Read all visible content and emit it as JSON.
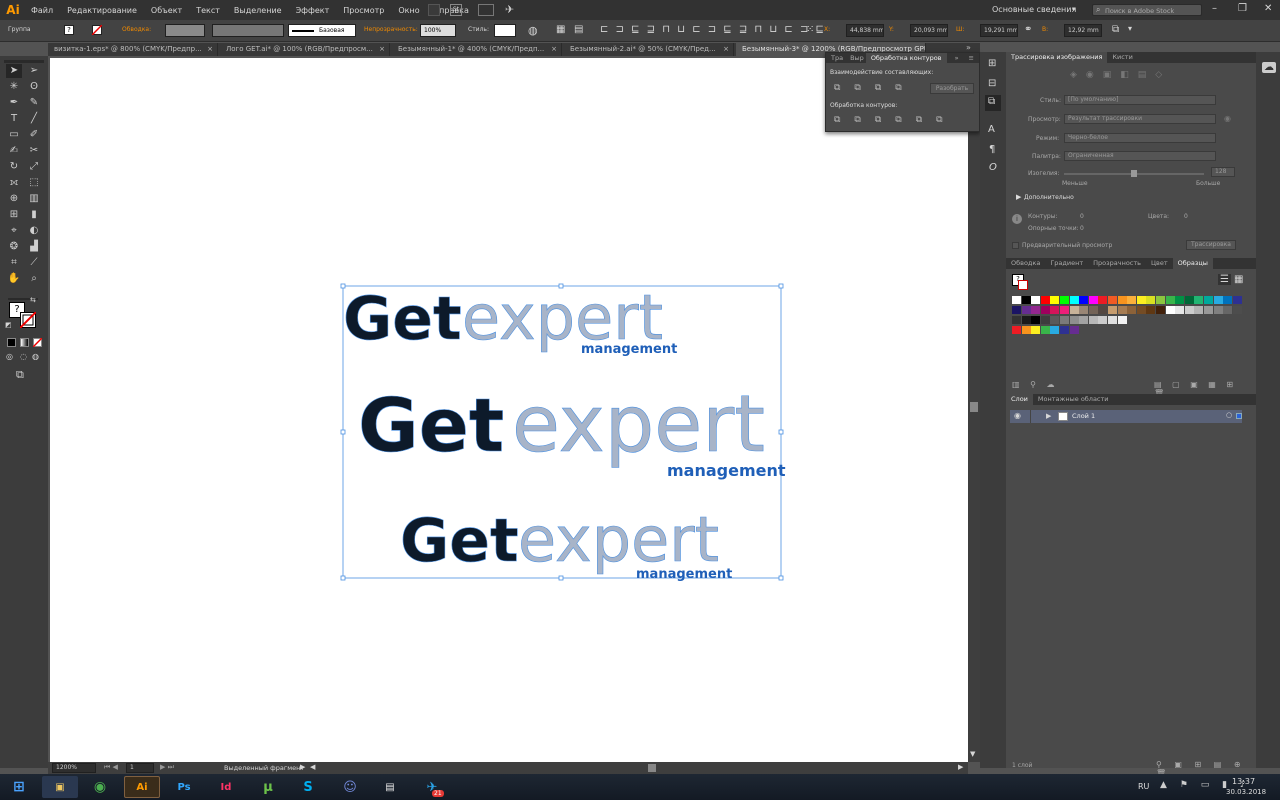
{
  "menubar": {
    "logo": "Ai",
    "items": [
      "Файл",
      "Редактирование",
      "Объект",
      "Текст",
      "Выделение",
      "Эффект",
      "Просмотр",
      "Окно",
      "Справка"
    ],
    "workspace": "Основные сведения",
    "search_placeholder": "Поиск в Adobe Stock"
  },
  "control_bar": {
    "selection_type": "Группа",
    "stroke_label": "Обводка:",
    "stroke_profile": "Базовая",
    "opacity_label": "Непрозрачность:",
    "opacity_value": "100%",
    "style_label": "Стиль:",
    "x_label": "X:",
    "x_value": "44,838 mm",
    "y_label": "Y:",
    "y_value": "20,093 mm",
    "w_label": "Ш:",
    "w_value": "19,291 mm",
    "h_label": "В:",
    "h_value": "12,92 mm"
  },
  "doc_tabs": [
    {
      "label": "визитка-1.eps* @ 800% (CMYK/Предпр...",
      "active": false
    },
    {
      "label": "Лого GET.ai* @ 100% (RGB/Предпросм...",
      "active": false
    },
    {
      "label": "Безымянный-1* @ 400% (CMYK/Предп...",
      "active": false
    },
    {
      "label": "Безымянный-2.ai* @ 50% (CMYK/Пред...",
      "active": false
    },
    {
      "label": "Безымянный-3* @ 1200% (RGB/Предпросмотр GPU)",
      "active": true
    }
  ],
  "pathfinder_panel": {
    "tabs": [
      "Тра",
      "Выр",
      "Обработка контуров"
    ],
    "shape_modes_label": "Взаимодействие составляющих:",
    "expand_button": "Разобрать",
    "pathfinders_label": "Обработка контуров:"
  },
  "trace_panel": {
    "tabs": [
      "Трассировка изображения",
      "Кисти"
    ],
    "preset_label": "Стиль:",
    "preset_value": "[По умолчанию]",
    "view_label": "Просмотр:",
    "view_value": "Результат трассировки",
    "mode_label": "Режим:",
    "mode_value": "Черно-белое",
    "palette_label": "Палитра:",
    "palette_value": "Ограниченная",
    "threshold_label": "Изогелия:",
    "threshold_value": "128",
    "less_label": "Меньше",
    "more_label": "Больше",
    "advanced_label": "Дополнительно",
    "paths_label": "Контуры:",
    "paths_value": "0",
    "colors_label": "Цвета:",
    "colors_value": "0",
    "anchors_label": "Опорные точки:",
    "anchors_value": "0",
    "preview_label": "Предварительный просмотр",
    "trace_button": "Трассировка"
  },
  "swatches_panel": {
    "tabs": [
      "Обводка",
      "Градиент",
      "Прозрачность",
      "Цвет",
      "Образцы"
    ],
    "active_tab": "Образцы",
    "row1": [
      "#ffffff",
      "#000000",
      "#ffffff",
      "#ff0000",
      "#ffff00",
      "#00ff00",
      "#00ffff",
      "#0000ff",
      "#ff00ff",
      "#ed1c24",
      "#f15a24",
      "#f7931e",
      "#fbb03b",
      "#fcee21",
      "#d9e021",
      "#8cc63f",
      "#39b54a",
      "#009245",
      "#006837",
      "#22b573",
      "#00a99d",
      "#29abe2",
      "#0071bc",
      "#2e3192"
    ],
    "row2": [
      "#1b1464",
      "#662d91",
      "#93278f",
      "#9e005d",
      "#d4145a",
      "#ed1e79",
      "#c7b299",
      "#998675",
      "#736357",
      "#534741",
      "#c69c6d",
      "#a67c52",
      "#8c6239",
      "#754c24",
      "#603813",
      "#42210b",
      "#ffffff",
      "#e6e6e6",
      "#cccccc",
      "#b3b3b3",
      "#999999",
      "#808080",
      "#666666",
      "#4d4d4d"
    ],
    "row3": [
      "#333333",
      "#1a1a1a",
      "#000000",
      "#3d3d3d",
      "#5a5a5a",
      "#7a7a7a",
      "#8f8f8f",
      "#a3a3a3",
      "#b8b8b8",
      "#cccccc",
      "#e0e0e0",
      "#f2f2f2"
    ],
    "row4": [
      "#ed1c24",
      "#f7931e",
      "#fcee21",
      "#39b54a",
      "#29abe2",
      "#2e3192",
      "#662d91"
    ]
  },
  "layers_panel": {
    "tabs": [
      "Слои",
      "Монтажные области"
    ],
    "layer_name": "Слой 1",
    "footer_count": "1 слой"
  },
  "status_bar": {
    "zoom": "1200%",
    "artboard_num": "1",
    "status_text": "Выделенный фрагмент"
  },
  "artwork": {
    "logo_get": "Get",
    "logo_expert": "expert",
    "logo_sub": "management",
    "dark_color": "#0d1a2a",
    "grey_color": "#a8b4c8",
    "blue_color": "#1f5fb8"
  },
  "taskbar": {
    "lang": "RU",
    "time": "13:37",
    "date": "30.03.2018",
    "badge": "21"
  }
}
